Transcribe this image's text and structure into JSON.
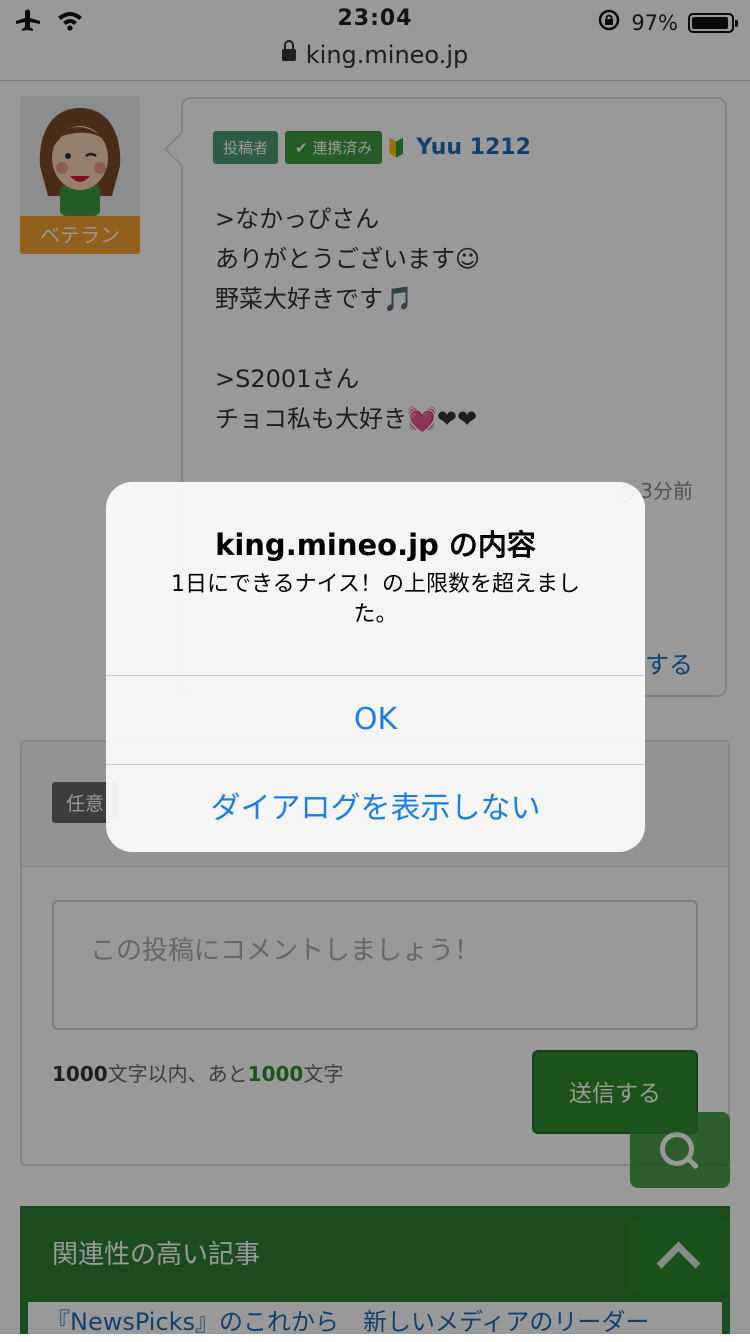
{
  "status_bar": {
    "time": "23:04",
    "battery": "97%"
  },
  "browser": {
    "url": "king.mineo.jp"
  },
  "post": {
    "avatar_badge": "ベテラン",
    "tag_poster": "投稿者",
    "tag_linked": "連携済み",
    "username": "Yuu 1212",
    "body": ">なかっぴさん\nありがとうございます☺\n野菜大好きです🎵\n\n>S2001さん\nチョコ私も大好き💓❤❤",
    "time": "3分前",
    "action_partial": "する"
  },
  "comment": {
    "optional_tag": "任意",
    "placeholder": "この投稿にコメントしましょう！",
    "counter_max": "1000",
    "counter_text1": "文字以内、あと",
    "counter_remaining": "1000",
    "counter_text2": "文字",
    "send_label": "送信する"
  },
  "related": {
    "title": "関連性の高い記事",
    "first_link": "『NewsPicks』のこれから　新しいメディアのリーダー"
  },
  "dialog": {
    "title": "king.mineo.jp の内容",
    "message": "1日にできるナイス！の上限数を超えました。",
    "ok_label": "OK",
    "hide_label": "ダイアログを表示しない"
  }
}
